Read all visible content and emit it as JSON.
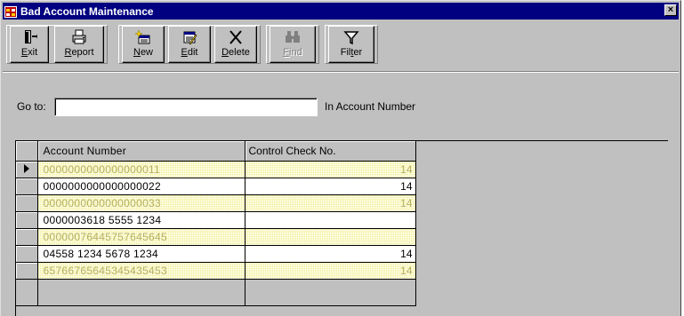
{
  "window": {
    "title": "Bad Account Maintenance",
    "close_label": "×"
  },
  "toolbar": {
    "buttons": [
      {
        "id": "exit",
        "pre": "",
        "ul": "E",
        "post": "xit",
        "icon": "exit-door-icon",
        "enabled": true
      },
      {
        "id": "report",
        "pre": "",
        "ul": "R",
        "post": "eport",
        "icon": "printer-icon",
        "enabled": true
      },
      {
        "id": "new",
        "pre": "",
        "ul": "N",
        "post": "ew",
        "icon": "new-record-icon",
        "enabled": true
      },
      {
        "id": "edit",
        "pre": "",
        "ul": "E",
        "post": "dit",
        "icon": "edit-record-icon",
        "enabled": true
      },
      {
        "id": "delete",
        "pre": "",
        "ul": "D",
        "post": "elete",
        "icon": "delete-x-icon",
        "enabled": true
      },
      {
        "id": "find",
        "pre": "",
        "ul": "F",
        "post": "ind",
        "icon": "binoculars-icon",
        "enabled": false
      },
      {
        "id": "filter",
        "pre": "Fil",
        "ul": "t",
        "post": "er",
        "icon": "funnel-icon",
        "enabled": true
      }
    ]
  },
  "goto": {
    "label": "Go to:",
    "value": "",
    "suffix": "In Account Number"
  },
  "grid": {
    "columns": [
      "Account Number",
      "Control Check No."
    ],
    "current_row": 0,
    "rows": [
      {
        "account": "0000000000000000011",
        "control": "14",
        "style": "hl"
      },
      {
        "account": "0000000000000000022",
        "control": "14",
        "style": "wt"
      },
      {
        "account": "0000000000000000033",
        "control": "14",
        "style": "hl"
      },
      {
        "account": "0000003618 5555 1234",
        "control": "",
        "style": "wt"
      },
      {
        "account": "0000007644575764564​5",
        "control": "",
        "style": "hl"
      },
      {
        "account": "04558 1234 5678 1234",
        "control": "14",
        "style": "wt"
      },
      {
        "account": "65766765645345435453",
        "control": "14",
        "style": "hl"
      }
    ]
  },
  "colors": {
    "title_bar": "#000080",
    "face": "#c0c0c0",
    "highlight_row_text": "#b5ae62",
    "highlight_row_dots": "#f2ef9c"
  }
}
